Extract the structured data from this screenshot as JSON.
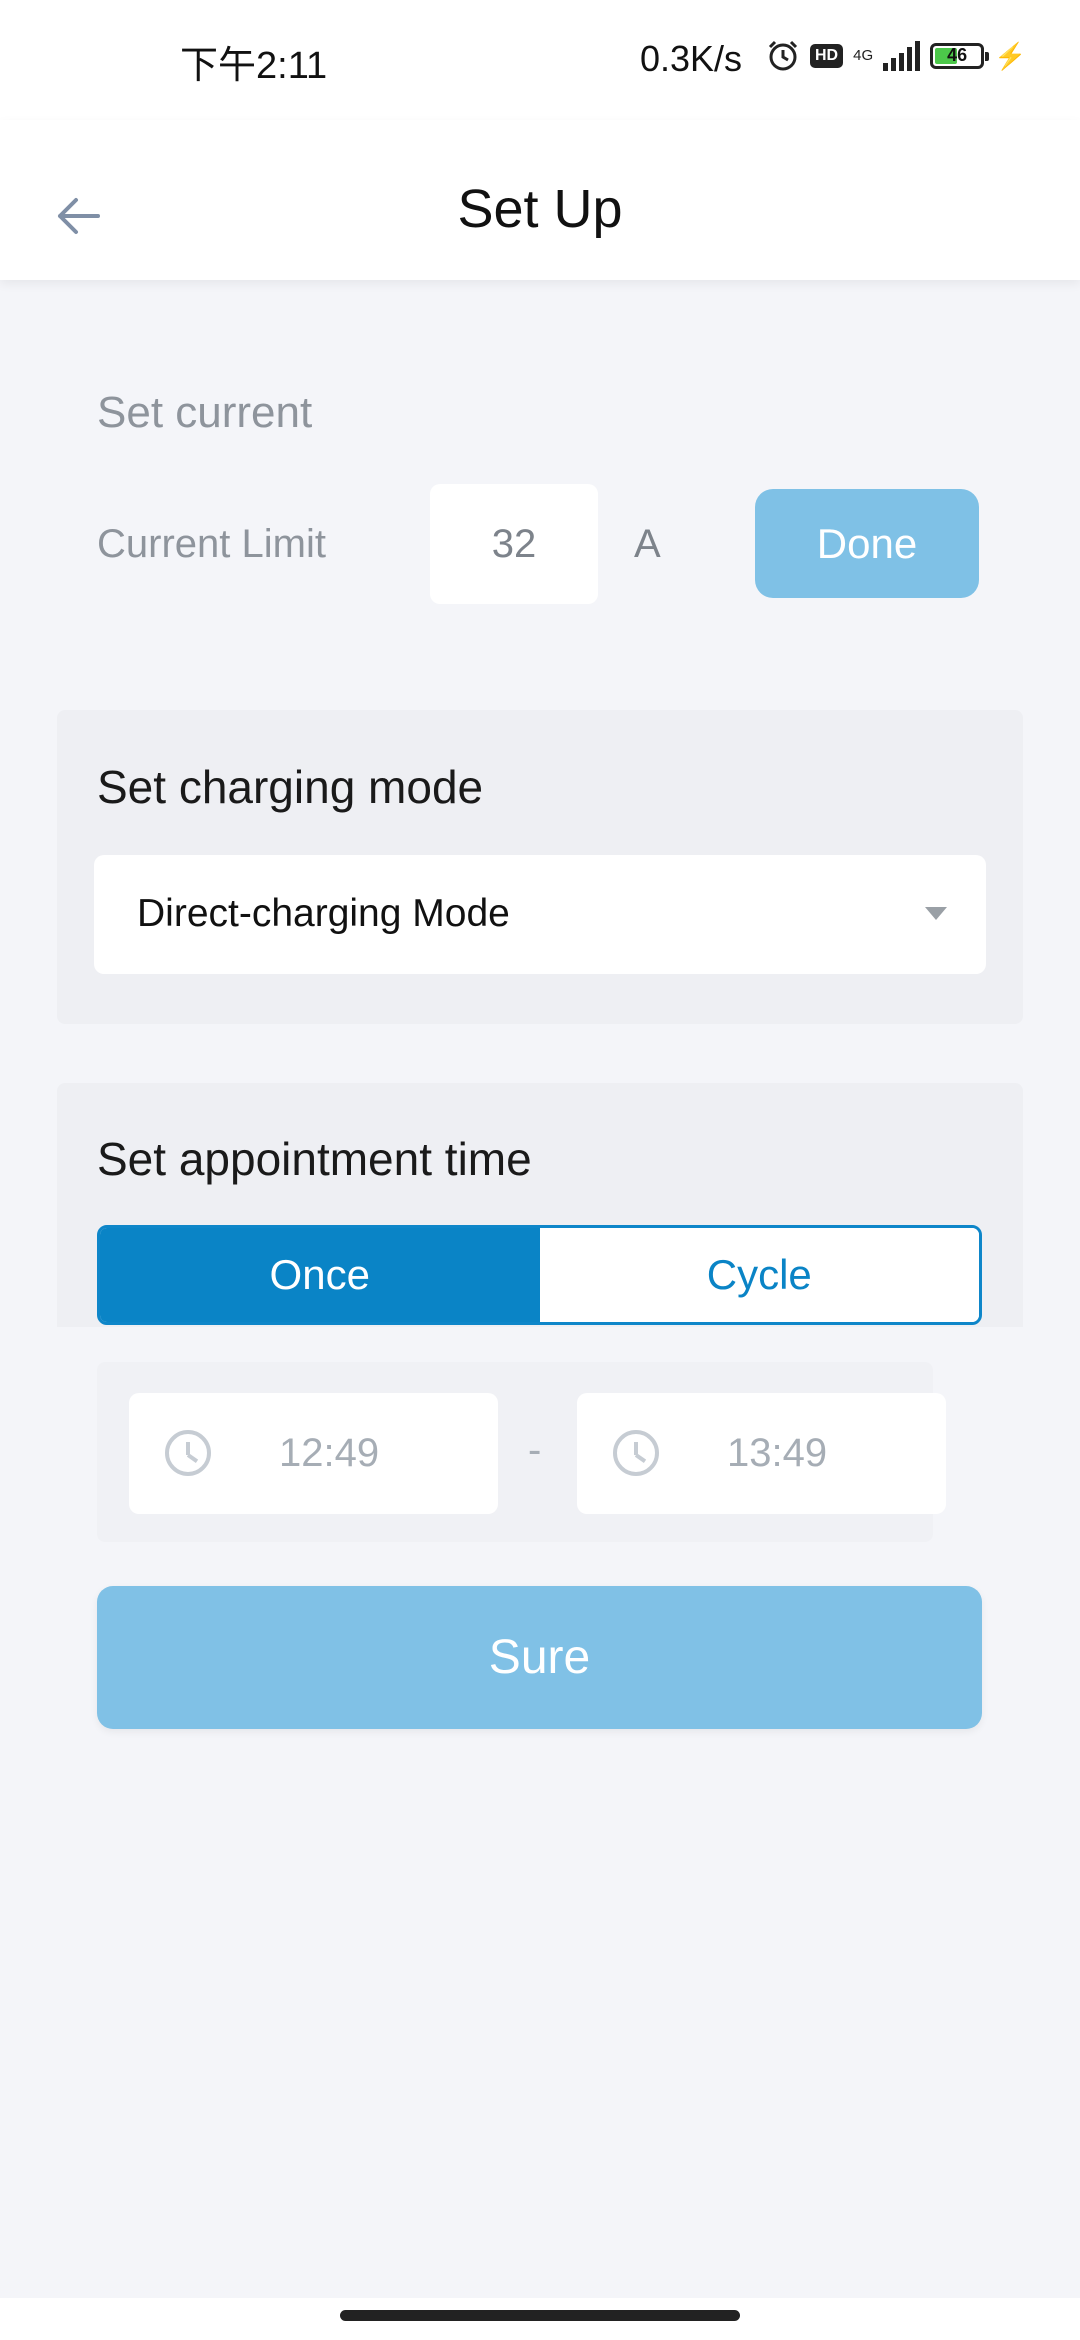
{
  "status_bar": {
    "time": "下午2:11",
    "net_speed": "0.3K/s",
    "hd": "HD",
    "network": "4G",
    "battery_level": "46"
  },
  "header": {
    "title": "Set Up"
  },
  "current": {
    "section_title": "Set current",
    "limit_label": "Current Limit",
    "limit_value": "32",
    "unit": "A",
    "done_label": "Done"
  },
  "charging_mode": {
    "section_title": "Set charging mode",
    "selected": "Direct-charging Mode"
  },
  "appointment": {
    "section_title": "Set appointment time",
    "tabs": [
      {
        "label": "Once",
        "active": true
      },
      {
        "label": "Cycle",
        "active": false
      }
    ],
    "start_time": "12:49",
    "separator": "-",
    "end_time": "13:49",
    "sure_label": "Sure"
  },
  "colors": {
    "accent": "#0a84c6",
    "button_light": "#80c1e6",
    "background": "#f4f5f9"
  }
}
